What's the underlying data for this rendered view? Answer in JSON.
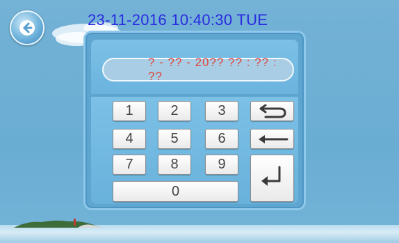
{
  "header": {
    "datetime": "23-11-2016  10:40:30  TUE",
    "back_icon": "back-arrow-icon"
  },
  "display": {
    "value": "? - ?? - 20??   ?? : ?? : ??"
  },
  "keypad": {
    "keys": [
      "1",
      "2",
      "3",
      "4",
      "5",
      "6",
      "7",
      "8",
      "9",
      "0"
    ],
    "undo_icon": "undo-icon",
    "backspace_icon": "backspace-arrow-icon",
    "enter_icon": "enter-icon"
  },
  "colors": {
    "datetime": "#2a2ae0",
    "display_text": "#e0453a",
    "background": "#6aadd3"
  }
}
